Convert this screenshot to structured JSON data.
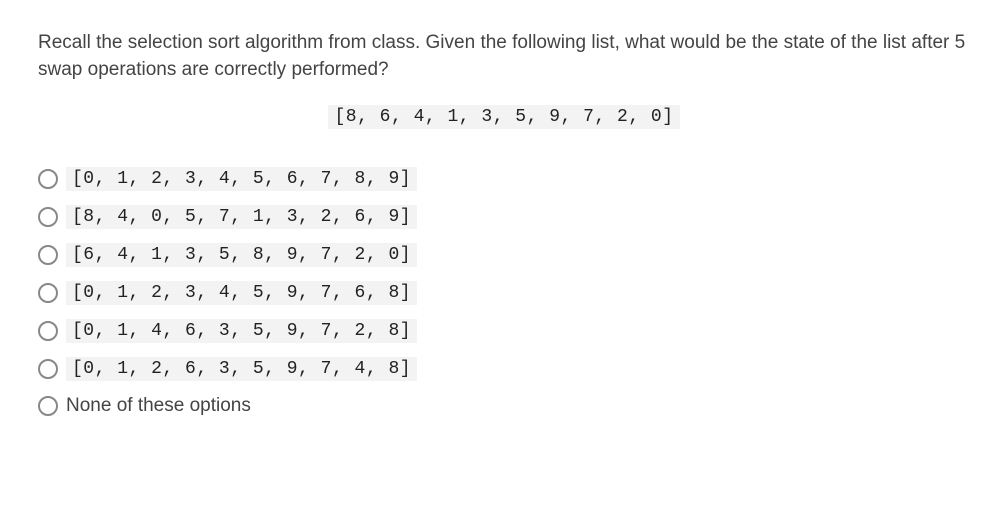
{
  "question": {
    "text": "Recall the selection sort algorithm from class. Given the following list, what would be the state of the list after 5 swap operations are correctly performed?",
    "given_list": "[8, 6, 4, 1, 3, 5, 9, 7, 2, 0]"
  },
  "options": [
    {
      "type": "code",
      "text": "[0, 1, 2, 3, 4, 5, 6, 7, 8, 9]"
    },
    {
      "type": "code",
      "text": "[8, 4, 0, 5, 7, 1, 3, 2, 6, 9]"
    },
    {
      "type": "code",
      "text": "[6, 4, 1, 3, 5, 8, 9, 7, 2, 0]"
    },
    {
      "type": "code",
      "text": "[0, 1, 2, 3, 4, 5, 9, 7, 6, 8]"
    },
    {
      "type": "code",
      "text": "[0, 1, 4, 6, 3, 5, 9, 7, 2, 8]"
    },
    {
      "type": "code",
      "text": "[0, 1, 2, 6, 3, 5, 9, 7, 4, 8]"
    },
    {
      "type": "text",
      "text": "None of these options"
    }
  ]
}
